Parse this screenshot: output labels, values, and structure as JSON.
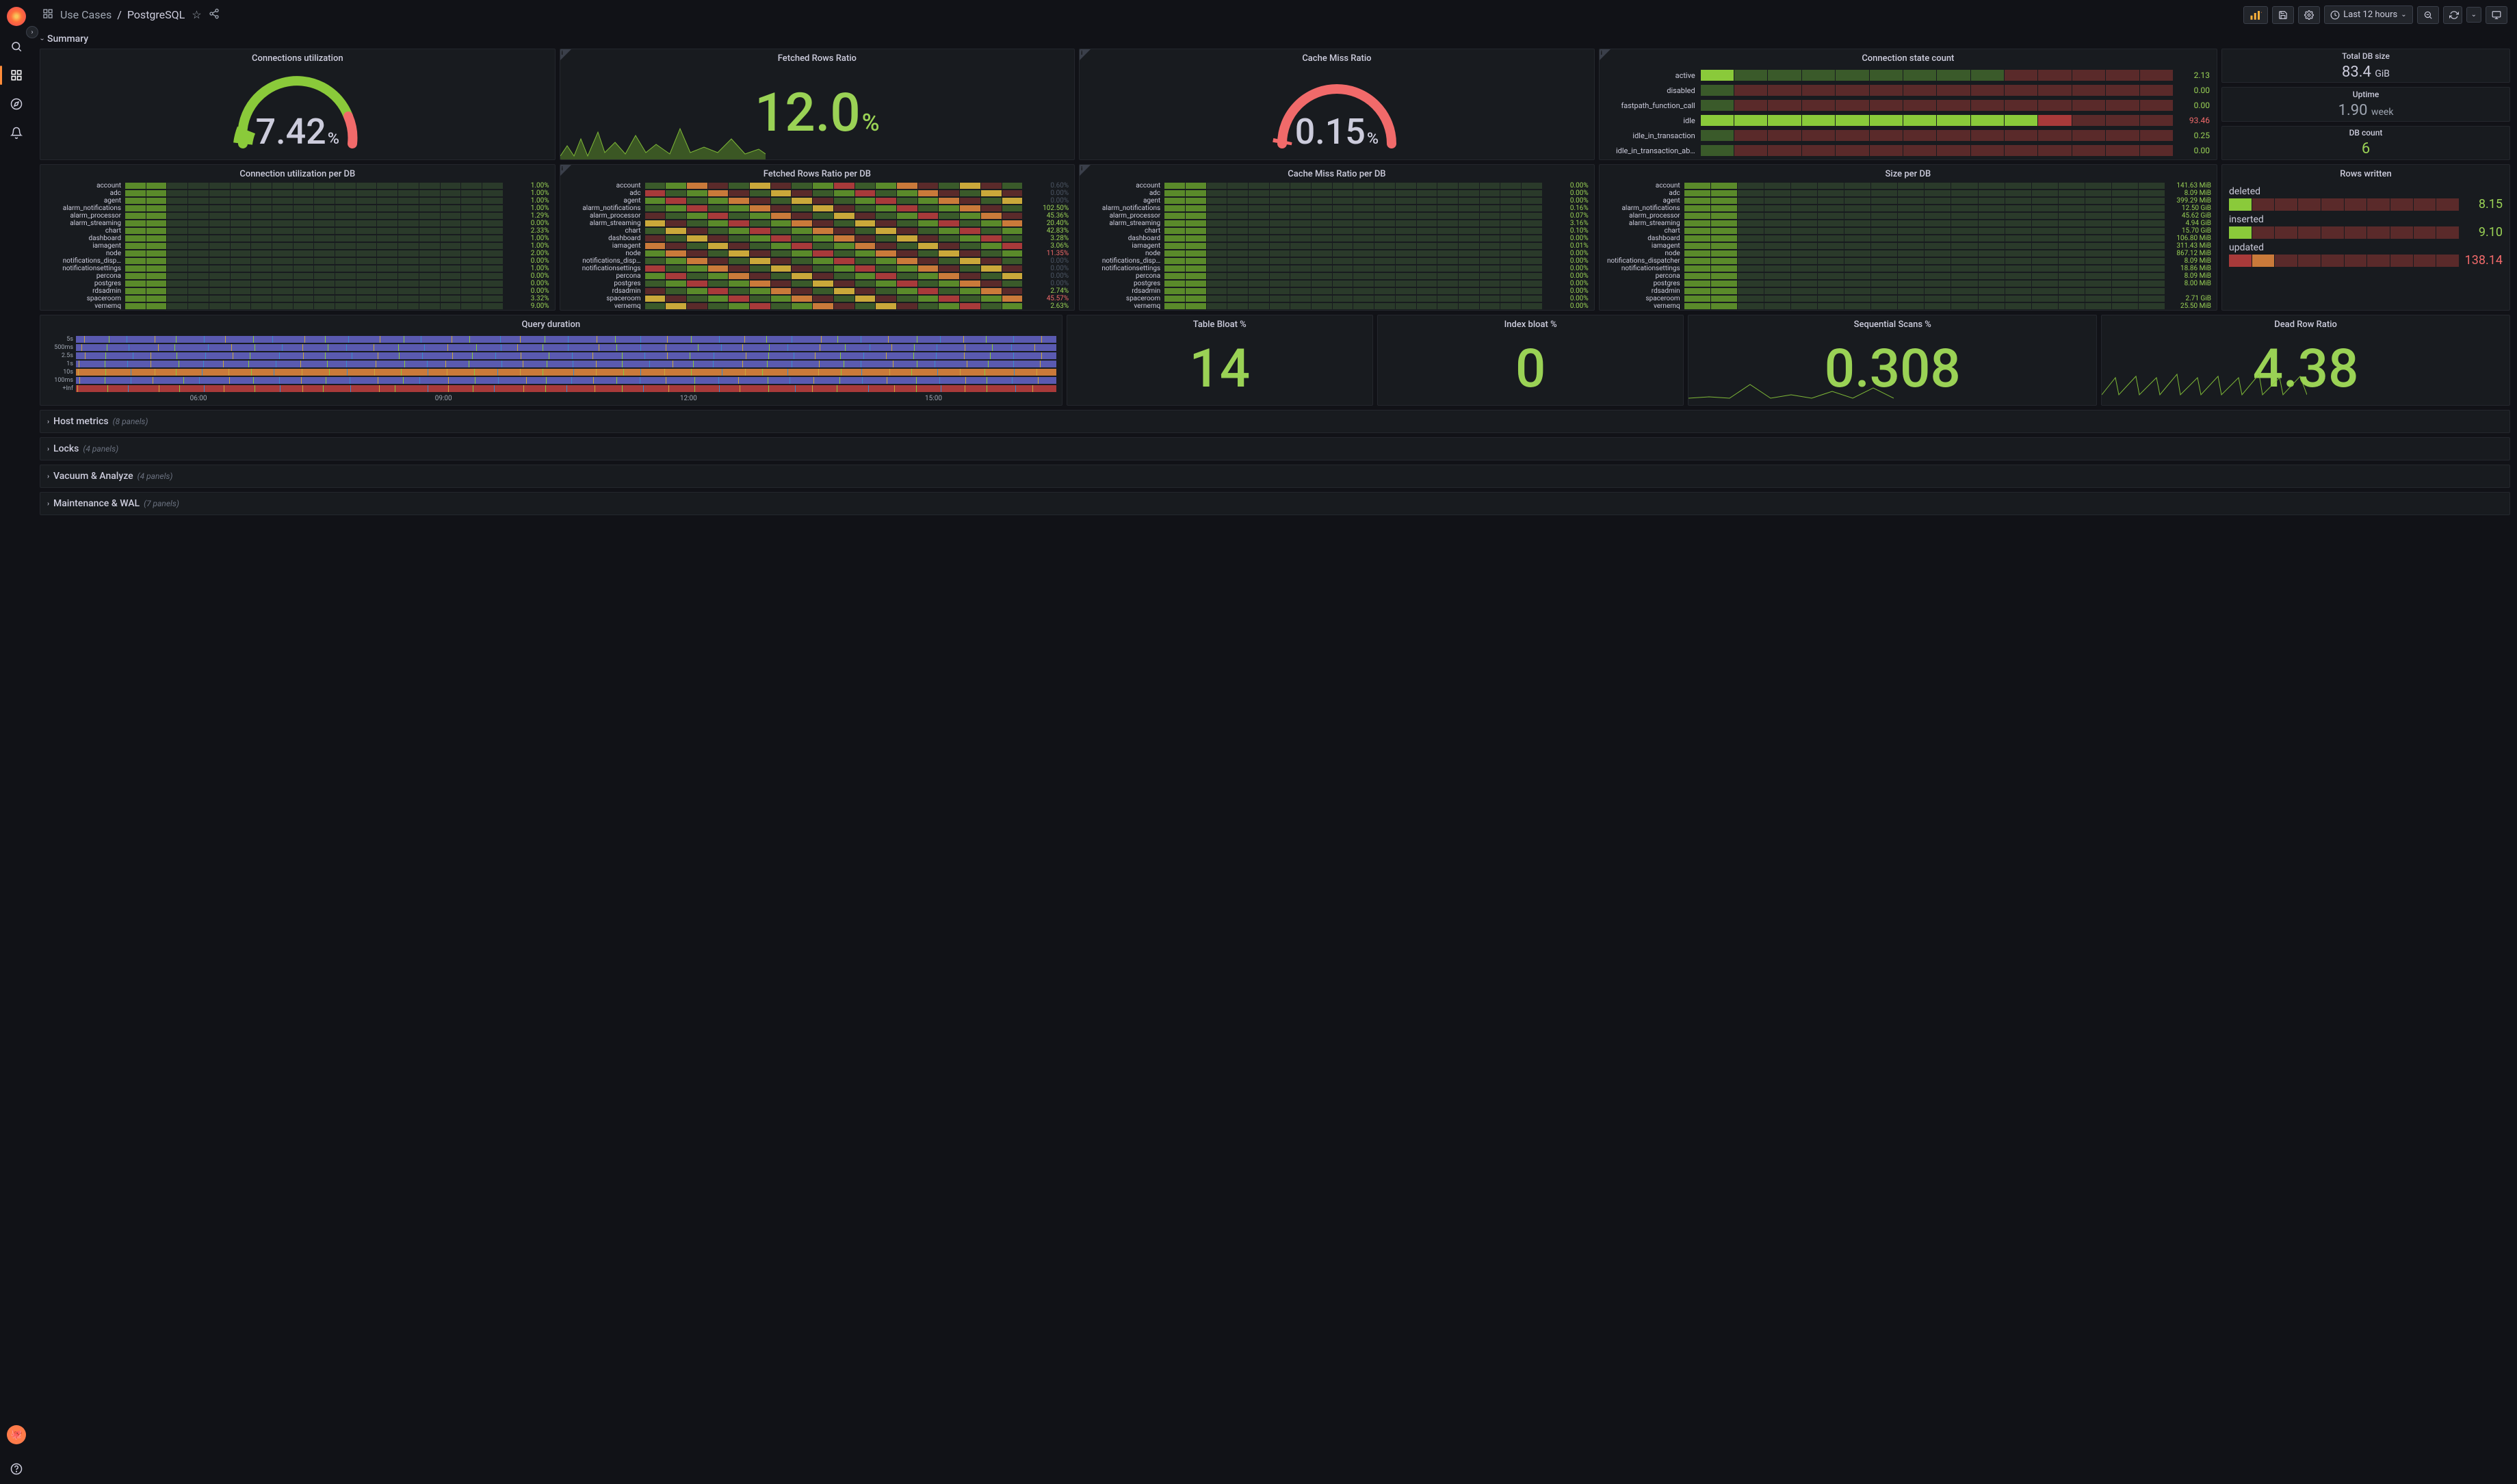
{
  "header": {
    "breadcrumb_root": "Use Cases",
    "breadcrumb_page": "PostgreSQL",
    "time_range": "Last 12 hours"
  },
  "summary_title": "Summary",
  "panels": {
    "conn_util": {
      "title": "Connections utilization",
      "value": "7.42",
      "unit": "%"
    },
    "fetched_ratio": {
      "title": "Fetched Rows Ratio",
      "value": "12.0",
      "unit": "%"
    },
    "cache_miss": {
      "title": "Cache Miss Ratio",
      "value": "0.15",
      "unit": "%"
    },
    "conn_state": {
      "title": "Connection state count",
      "rows": [
        {
          "lbl": "active",
          "val": "2.13",
          "cls": "green"
        },
        {
          "lbl": "disabled",
          "val": "0.00",
          "cls": "green"
        },
        {
          "lbl": "fastpath_function_call",
          "val": "0.00",
          "cls": "green"
        },
        {
          "lbl": "idle",
          "val": "93.46",
          "cls": "red"
        },
        {
          "lbl": "idle_in_transaction",
          "val": "0.25",
          "cls": "green"
        },
        {
          "lbl": "idle_in_transaction_ab…",
          "val": "0.00",
          "cls": "green"
        }
      ]
    },
    "total_db_size": {
      "title": "Total DB size",
      "value": "83.4",
      "unit": "GiB"
    },
    "uptime": {
      "title": "Uptime",
      "value": "1.90",
      "unit": "week"
    },
    "db_count": {
      "title": "DB count",
      "value": "6"
    },
    "conn_util_db": {
      "title": "Connection utilization per DB",
      "rows": [
        {
          "lbl": "account",
          "val": "1.00%",
          "cls": "green"
        },
        {
          "lbl": "adc",
          "val": "1.00%",
          "cls": "green"
        },
        {
          "lbl": "agent",
          "val": "1.00%",
          "cls": "green"
        },
        {
          "lbl": "alarm_notifications",
          "val": "1.00%",
          "cls": "green"
        },
        {
          "lbl": "alarm_processor",
          "val": "1.29%",
          "cls": "green"
        },
        {
          "lbl": "alarm_streaming",
          "val": "0.00%",
          "cls": "green"
        },
        {
          "lbl": "chart",
          "val": "2.33%",
          "cls": "green"
        },
        {
          "lbl": "dashboard",
          "val": "1.00%",
          "cls": "green"
        },
        {
          "lbl": "iamagent",
          "val": "1.00%",
          "cls": "green"
        },
        {
          "lbl": "node",
          "val": "2.00%",
          "cls": "green"
        },
        {
          "lbl": "notifications_disp…",
          "val": "0.00%",
          "cls": "green"
        },
        {
          "lbl": "notificationsettings",
          "val": "1.00%",
          "cls": "green"
        },
        {
          "lbl": "percona",
          "val": "0.00%",
          "cls": "green"
        },
        {
          "lbl": "postgres",
          "val": "0.00%",
          "cls": "green"
        },
        {
          "lbl": "rdsadmin",
          "val": "0.00%",
          "cls": "green"
        },
        {
          "lbl": "spaceroom",
          "val": "3.32%",
          "cls": "green"
        },
        {
          "lbl": "vernemq",
          "val": "9.00%",
          "cls": "green"
        }
      ]
    },
    "fetched_db": {
      "title": "Fetched Rows Ratio per DB",
      "rows": [
        {
          "lbl": "account",
          "val": "0.60%",
          "cls": "dim"
        },
        {
          "lbl": "adc",
          "val": "0.00%",
          "cls": "dim"
        },
        {
          "lbl": "agent",
          "val": "0.00%",
          "cls": "dim"
        },
        {
          "lbl": "alarm_notifications",
          "val": "102.50%",
          "cls": "green"
        },
        {
          "lbl": "alarm_processor",
          "val": "45.36%",
          "cls": "green"
        },
        {
          "lbl": "alarm_streaming",
          "val": "20.40%",
          "cls": "green"
        },
        {
          "lbl": "chart",
          "val": "42.83%",
          "cls": "green"
        },
        {
          "lbl": "dashboard",
          "val": "3.28%",
          "cls": "green"
        },
        {
          "lbl": "iamagent",
          "val": "3.06%",
          "cls": "green"
        },
        {
          "lbl": "node",
          "val": "11.35%",
          "cls": "red"
        },
        {
          "lbl": "notifications_disp…",
          "val": "0.00%",
          "cls": "dim"
        },
        {
          "lbl": "notificationsettings",
          "val": "0.00%",
          "cls": "dim"
        },
        {
          "lbl": "percona",
          "val": "0.00%",
          "cls": "dim"
        },
        {
          "lbl": "postgres",
          "val": "0.00%",
          "cls": "dim"
        },
        {
          "lbl": "rdsadmin",
          "val": "2.74%",
          "cls": "green"
        },
        {
          "lbl": "spaceroom",
          "val": "45.57%",
          "cls": "red"
        },
        {
          "lbl": "vernemq",
          "val": "2.63%",
          "cls": "green"
        }
      ]
    },
    "cache_miss_db": {
      "title": "Cache Miss Ratio per DB",
      "rows": [
        {
          "lbl": "account",
          "val": "0.00%",
          "cls": "green"
        },
        {
          "lbl": "adc",
          "val": "0.00%",
          "cls": "green"
        },
        {
          "lbl": "agent",
          "val": "0.00%",
          "cls": "green"
        },
        {
          "lbl": "alarm_notifications",
          "val": "0.16%",
          "cls": "green"
        },
        {
          "lbl": "alarm_processor",
          "val": "0.07%",
          "cls": "green"
        },
        {
          "lbl": "alarm_streaming",
          "val": "3.16%",
          "cls": "green"
        },
        {
          "lbl": "chart",
          "val": "0.10%",
          "cls": "green"
        },
        {
          "lbl": "dashboard",
          "val": "0.00%",
          "cls": "green"
        },
        {
          "lbl": "iamagent",
          "val": "0.01%",
          "cls": "green"
        },
        {
          "lbl": "node",
          "val": "0.00%",
          "cls": "green"
        },
        {
          "lbl": "notifications_disp…",
          "val": "0.00%",
          "cls": "green"
        },
        {
          "lbl": "notificationsettings",
          "val": "0.00%",
          "cls": "green"
        },
        {
          "lbl": "percona",
          "val": "0.00%",
          "cls": "green"
        },
        {
          "lbl": "postgres",
          "val": "0.00%",
          "cls": "green"
        },
        {
          "lbl": "rdsadmin",
          "val": "0.00%",
          "cls": "green"
        },
        {
          "lbl": "spaceroom",
          "val": "0.00%",
          "cls": "green"
        },
        {
          "lbl": "vernemq",
          "val": "0.00%",
          "cls": "green"
        }
      ]
    },
    "size_db": {
      "title": "Size per DB",
      "rows": [
        {
          "lbl": "account",
          "val": "141.63 MiB",
          "cls": "green"
        },
        {
          "lbl": "adc",
          "val": "8.09 MiB",
          "cls": "green"
        },
        {
          "lbl": "agent",
          "val": "399.29 MiB",
          "cls": "green"
        },
        {
          "lbl": "alarm_notifications",
          "val": "12.50 GiB",
          "cls": "green"
        },
        {
          "lbl": "alarm_processor",
          "val": "45.62 GiB",
          "cls": "green"
        },
        {
          "lbl": "alarm_streaming",
          "val": "4.94 GiB",
          "cls": "green"
        },
        {
          "lbl": "chart",
          "val": "15.70 GiB",
          "cls": "green"
        },
        {
          "lbl": "dashboard",
          "val": "106.80 MiB",
          "cls": "green"
        },
        {
          "lbl": "iamagent",
          "val": "311.43 MiB",
          "cls": "green"
        },
        {
          "lbl": "node",
          "val": "867.12 MiB",
          "cls": "green"
        },
        {
          "lbl": "notifications_dispatcher",
          "val": "8.09 MiB",
          "cls": "green"
        },
        {
          "lbl": "notificationsettings",
          "val": "18.86 MiB",
          "cls": "green"
        },
        {
          "lbl": "percona",
          "val": "8.09 MiB",
          "cls": "green"
        },
        {
          "lbl": "postgres",
          "val": "8.00 MiB",
          "cls": "green"
        },
        {
          "lbl": "rdsadmin",
          "val": "",
          "cls": "dim"
        },
        {
          "lbl": "spaceroom",
          "val": "2.71 GiB",
          "cls": "green"
        },
        {
          "lbl": "vernemq",
          "val": "25.50 MiB",
          "cls": "green"
        }
      ]
    },
    "rows_written": {
      "title": "Rows written",
      "items": [
        {
          "lbl": "deleted",
          "val": "8.15",
          "cls": "green"
        },
        {
          "lbl": "inserted",
          "val": "9.10",
          "cls": "green"
        },
        {
          "lbl": "updated",
          "val": "138.14",
          "cls": "red"
        }
      ]
    },
    "query_duration": {
      "title": "Query duration",
      "lanes": [
        "5s",
        "500ms",
        "2.5s",
        "1s",
        "10s",
        "100ms",
        "+Inf"
      ],
      "axis": [
        "06:00",
        "09:00",
        "12:00",
        "15:00"
      ]
    },
    "table_bloat": {
      "title": "Table Bloat %",
      "value": "14"
    },
    "index_bloat": {
      "title": "Index bloat %",
      "value": "0"
    },
    "seq_scans": {
      "title": "Sequential Scans %",
      "value": "0.308"
    },
    "dead_row": {
      "title": "Dead Row Ratio",
      "value": "4.38"
    }
  },
  "collapsed_rows": [
    {
      "title": "Host metrics",
      "count": "(8 panels)"
    },
    {
      "title": "Locks",
      "count": "(4 panels)"
    },
    {
      "title": "Vacuum & Analyze",
      "count": "(4 panels)"
    },
    {
      "title": "Maintenance & WAL",
      "count": "(7 panels)"
    }
  ],
  "chart_data": {
    "gauges": [
      {
        "name": "Connections utilization",
        "value": 7.42,
        "min": 0,
        "max": 100,
        "thresholds": [
          80
        ]
      },
      {
        "name": "Cache Miss Ratio",
        "value": 0.15,
        "min": 0,
        "max": 100,
        "thresholds": [
          80
        ]
      }
    ],
    "big_stats": [
      {
        "name": "Fetched Rows Ratio",
        "value": 12.0,
        "unit": "%"
      },
      {
        "name": "Total DB size",
        "value": 83.4,
        "unit": "GiB"
      },
      {
        "name": "Uptime",
        "value": 1.9,
        "unit": "week"
      },
      {
        "name": "DB count",
        "value": 6
      },
      {
        "name": "Table Bloat %",
        "value": 14
      },
      {
        "name": "Index bloat %",
        "value": 0
      },
      {
        "name": "Sequential Scans %",
        "value": 0.308
      },
      {
        "name": "Dead Row Ratio",
        "value": 4.38
      }
    ],
    "connection_state_count": {
      "active": 2.13,
      "disabled": 0.0,
      "fastpath_function_call": 0.0,
      "idle": 93.46,
      "idle_in_transaction": 0.25,
      "idle_in_transaction_aborted": 0.0
    },
    "rows_written": {
      "deleted": 8.15,
      "inserted": 9.1,
      "updated": 138.14
    },
    "query_duration": {
      "type": "heatmap",
      "y_buckets": [
        "5s",
        "500ms",
        "2.5s",
        "1s",
        "10s",
        "100ms",
        "+Inf"
      ],
      "x_ticks": [
        "06:00",
        "09:00",
        "12:00",
        "15:00"
      ],
      "note": "dense status-history heatmap; individual cell values not legible"
    }
  }
}
